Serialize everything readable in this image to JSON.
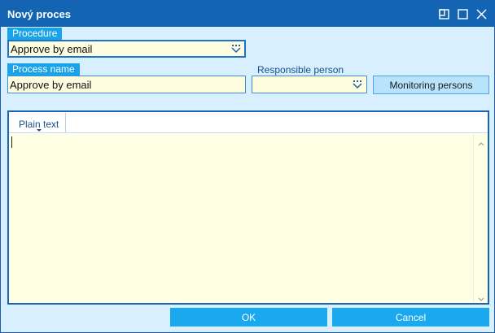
{
  "window": {
    "title": "Nový proces",
    "controls": {
      "restore": "restore-icon",
      "maximize": "maximize-icon",
      "close": "close-icon"
    }
  },
  "procedure": {
    "label": "Procedure",
    "value": "Approve by email",
    "dropdown_icon": "dotted-chevron-down-icon"
  },
  "process_name": {
    "label": "Process name",
    "value": "Approve by email"
  },
  "responsible_person": {
    "label": "Responsible person",
    "value": "",
    "dropdown_icon": "dotted-chevron-down-icon"
  },
  "monitoring_button": {
    "label": "Monitoring persons"
  },
  "editor": {
    "format_tab": "Plain text",
    "content": ""
  },
  "footer": {
    "ok_label": "OK",
    "cancel_label": "Cancel"
  },
  "colors": {
    "titlebar": "#1464b4",
    "background": "#d8efff",
    "label_tab": "#1aa3e8",
    "field_bg": "#fffde0",
    "footer_button": "#1aa8ef"
  }
}
